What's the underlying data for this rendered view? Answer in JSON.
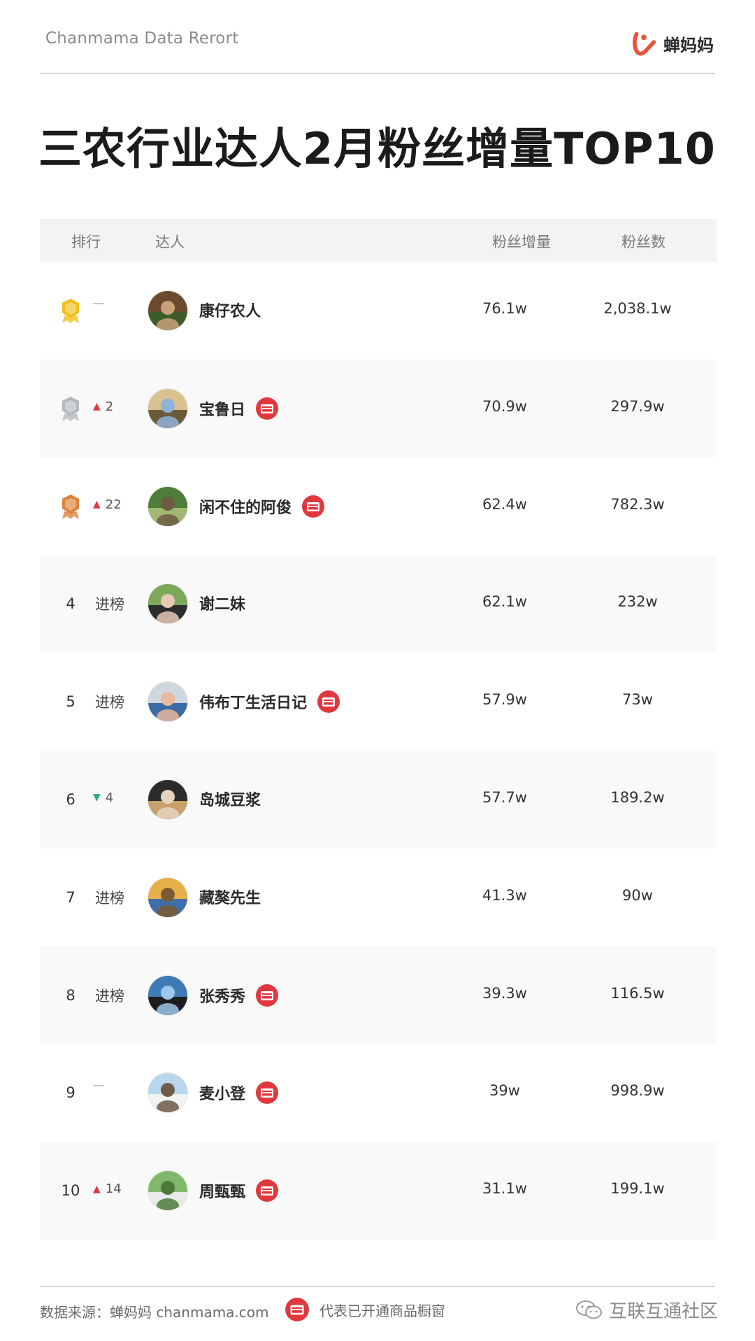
{
  "header": {
    "report_title": "Chanmama Data Rerort",
    "brand_name": "蝉妈妈"
  },
  "title": "三农行业达人2月粉丝增量TOP10",
  "table": {
    "columns": {
      "rank": "排行",
      "influencer": "达人",
      "follower_growth": "粉丝增量",
      "followers": "粉丝数"
    },
    "rows": [
      {
        "rank": "1",
        "medal": "gold",
        "change_type": "same",
        "change": "",
        "name": "康仔农人",
        "shop": false,
        "growth": "76.1w",
        "followers": "2,038.1w"
      },
      {
        "rank": "2",
        "medal": "silver",
        "change_type": "up",
        "change": "2",
        "name": "宝鲁日",
        "shop": true,
        "growth": "70.9w",
        "followers": "297.9w"
      },
      {
        "rank": "3",
        "medal": "bronze",
        "change_type": "up",
        "change": "22",
        "name": "闲不住的阿俊",
        "shop": true,
        "growth": "62.4w",
        "followers": "782.3w"
      },
      {
        "rank": "4",
        "medal": "",
        "change_type": "new",
        "change": "进榜",
        "name": "谢二妹",
        "shop": false,
        "growth": "62.1w",
        "followers": "232w"
      },
      {
        "rank": "5",
        "medal": "",
        "change_type": "new",
        "change": "进榜",
        "name": "伟布丁生活日记",
        "shop": true,
        "growth": "57.9w",
        "followers": "73w"
      },
      {
        "rank": "6",
        "medal": "",
        "change_type": "down",
        "change": "4",
        "name": "岛城豆浆",
        "shop": false,
        "growth": "57.7w",
        "followers": "189.2w"
      },
      {
        "rank": "7",
        "medal": "",
        "change_type": "new",
        "change": "进榜",
        "name": "藏獒先生",
        "shop": false,
        "growth": "41.3w",
        "followers": "90w"
      },
      {
        "rank": "8",
        "medal": "",
        "change_type": "new",
        "change": "进榜",
        "name": "张秀秀",
        "shop": true,
        "growth": "39.3w",
        "followers": "116.5w"
      },
      {
        "rank": "9",
        "medal": "",
        "change_type": "same",
        "change": "",
        "name": "麦小登",
        "shop": true,
        "growth": "39w",
        "followers": "998.9w"
      },
      {
        "rank": "10",
        "medal": "",
        "change_type": "up",
        "change": "14",
        "name": "周甄甄",
        "shop": true,
        "growth": "31.1w",
        "followers": "199.1w"
      }
    ]
  },
  "footer": {
    "source": "数据来源：蝉妈妈 chanmama.com",
    "legend": "代表已开通商品橱窗",
    "watermark": "互联互通社区"
  },
  "colors": {
    "accent": "#e0383e",
    "up": "#e0383e",
    "down": "#2fae7c",
    "gold": "#f2c01e",
    "silver": "#b5b8bd",
    "bronze": "#d9833b",
    "brand": "#e8553a"
  },
  "icons": {
    "brand_logo": "chanmama-logo-icon",
    "shop_window": "shop-window-icon",
    "watermark": "wechat-icon"
  }
}
